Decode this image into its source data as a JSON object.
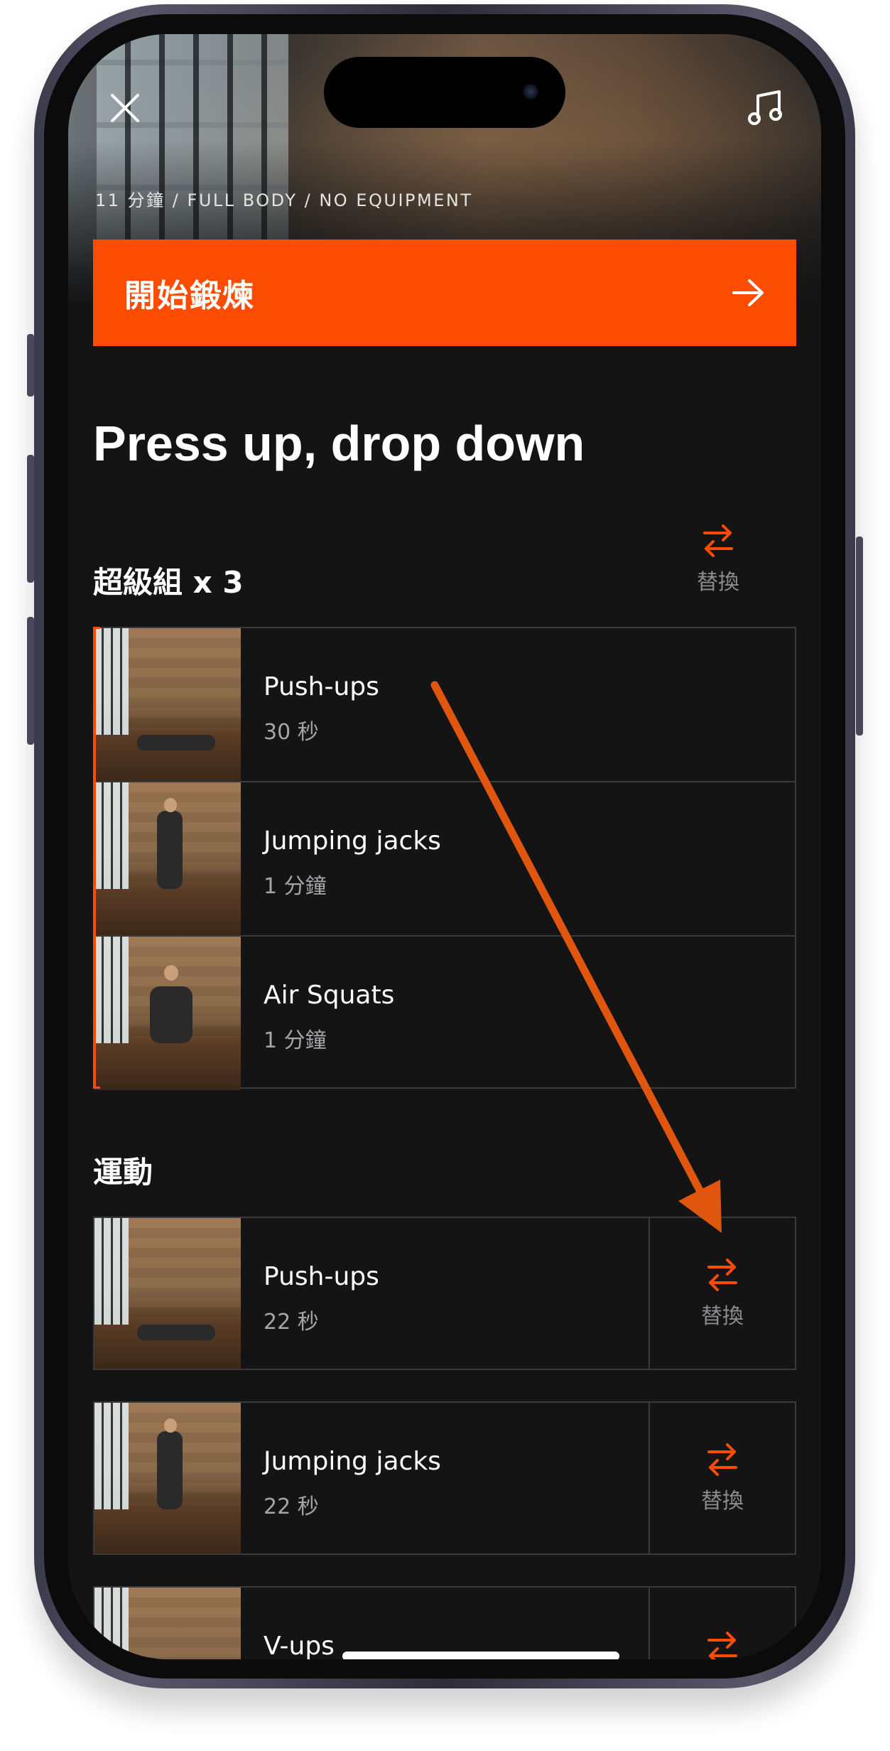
{
  "header": {
    "meta": "11 分鐘 / FULL BODY / NO EQUIPMENT",
    "close_icon": "close-icon",
    "music_icon": "music-note-icon"
  },
  "start_button": {
    "label": "開始鍛煉",
    "icon": "arrow-right-icon"
  },
  "workout_title": "Press up, drop down",
  "superset": {
    "title": "超級組 x 3",
    "swap_label": "替換",
    "exercises": [
      {
        "name": "Push-ups",
        "duration": "30 秒"
      },
      {
        "name": "Jumping jacks",
        "duration": "1 分鐘"
      },
      {
        "name": "Air Squats",
        "duration": "1 分鐘"
      }
    ]
  },
  "exercises_section": {
    "title": "運動",
    "items": [
      {
        "name": "Push-ups",
        "duration": "22 秒",
        "swap_label": "替換"
      },
      {
        "name": "Jumping jacks",
        "duration": "22 秒",
        "swap_label": "替換"
      },
      {
        "name": "V-ups",
        "duration": "",
        "swap_label": "替換"
      }
    ]
  },
  "colors": {
    "accent": "#fc4c02",
    "background": "#141415",
    "annotation_arrow": "#e0560e"
  }
}
